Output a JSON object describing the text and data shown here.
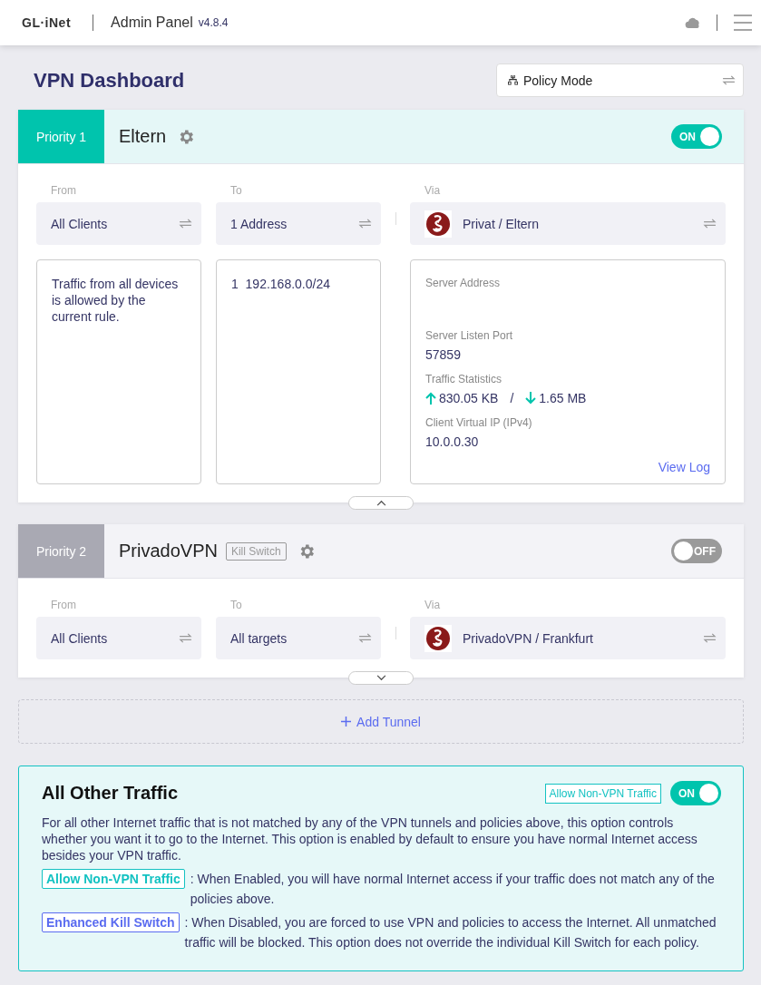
{
  "header": {
    "logo": "GL·iNet",
    "title": "Admin Panel",
    "version": "v4.8.4"
  },
  "page_title": "VPN Dashboard",
  "mode_selector": {
    "label": "Policy Mode"
  },
  "policies": [
    {
      "priority": "Priority 1",
      "name": "Eltern",
      "enabled": true,
      "toggle_label": "ON",
      "expanded": true,
      "from": {
        "label": "From",
        "value": "All Clients"
      },
      "to": {
        "label": "To",
        "value": "1 Address"
      },
      "via": {
        "label": "Via",
        "value": "Privat / Eltern"
      },
      "from_detail": "Traffic from all devices is allowed by the current rule.",
      "to_detail": [
        {
          "index": "1",
          "value": "192.168.0.0/24"
        }
      ],
      "server_details": [
        {
          "kind": "text",
          "label": "Server Address"
        },
        {
          "kind": "text",
          "label": "Server Listen Port",
          "value": "57859"
        },
        {
          "kind": "traffic",
          "label": "Traffic Statistics",
          "upload": "830.05 KB",
          "separator": "/",
          "download": "1.65 MB"
        },
        {
          "kind": "text",
          "label": "Client Virtual IP (IPv4)",
          "value": "10.0.0.30"
        }
      ],
      "view_log": "View Log"
    },
    {
      "priority": "Priority 2",
      "name": "PrivadoVPN",
      "kill_switch_badge": "Kill Switch",
      "enabled": false,
      "toggle_label": "OFF",
      "expanded": false,
      "from": {
        "label": "From",
        "value": "All Clients"
      },
      "to": {
        "label": "To",
        "value": "All targets"
      },
      "via": {
        "label": "Via",
        "value": "PrivadoVPN / Frankfurt"
      }
    }
  ],
  "add_tunnel": "Add Tunnel",
  "other_traffic": {
    "title": "All Other Traffic",
    "badge": "Allow Non-VPN Traffic",
    "enabled": true,
    "toggle_label": "ON",
    "description": "For all other Internet traffic that is not matched by any of the VPN tunnels and policies above, this option controls whether you want it to go to the Internet. This option is enabled by default to ensure you have normal Internet access besides your VPN traffic.",
    "notes": [
      {
        "tag": "Allow Non-VPN Traffic",
        "color": "#13c2c2",
        "text": ": When Enabled, you will have normal Internet access if your traffic does not match any of the policies above."
      },
      {
        "tag": "Enhanced Kill Switch",
        "color": "#5b6cf0",
        "text": ": When Disabled, you are forced to use VPN and policies to access the Internet. All unmatched traffic will be blocked. This option does not override the individual Kill Switch for each policy."
      }
    ]
  }
}
